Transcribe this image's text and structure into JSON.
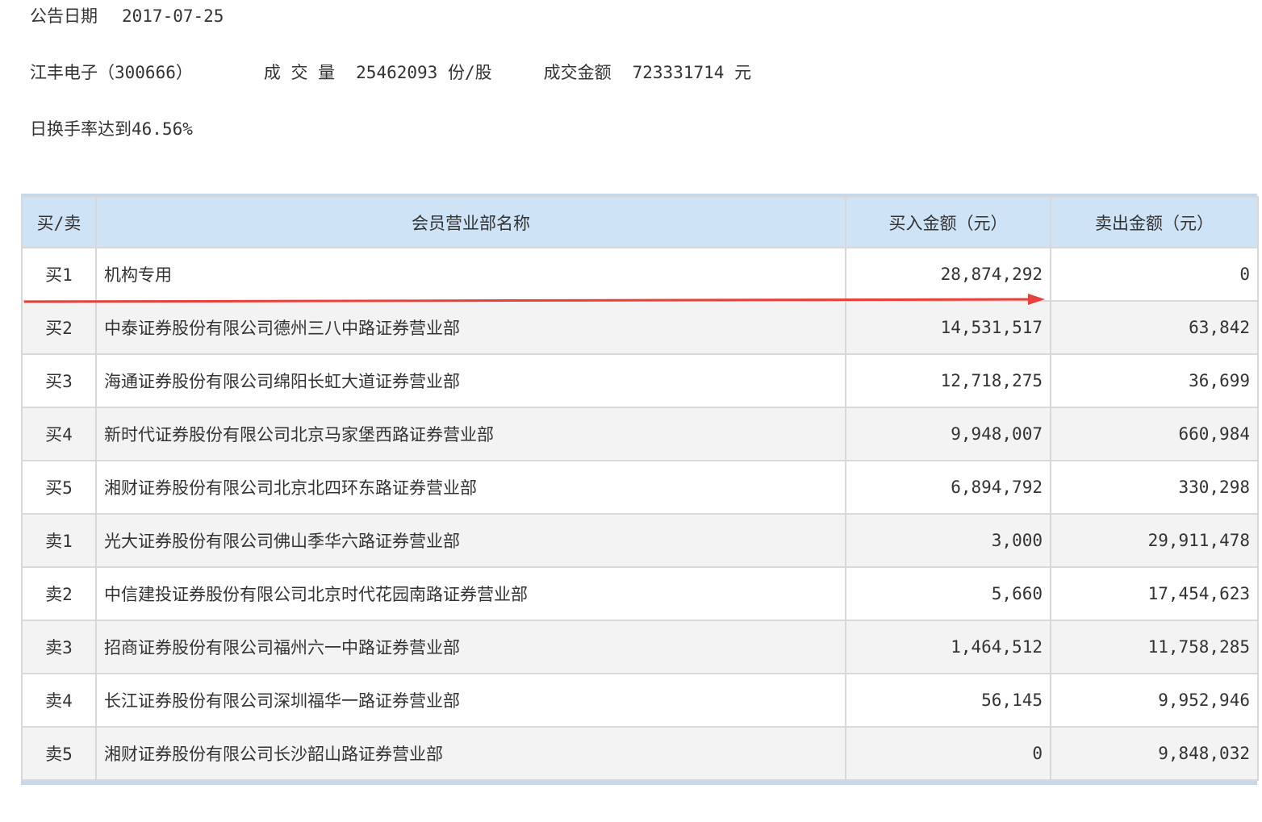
{
  "header": {
    "date_label": "公告日期",
    "date_value": "2017-07-25",
    "stock": "江丰电子（300666）",
    "volume_label": "成 交 量",
    "volume_value": "25462093",
    "volume_unit": "份/股",
    "amount_label": "成交金额",
    "amount_value": "723331714",
    "amount_unit": "元",
    "turnover_text": "日换手率达到46.56%"
  },
  "table": {
    "columns": [
      "买/卖",
      "会员营业部名称",
      "买入金额（元）",
      "卖出金额（元）"
    ],
    "rows": [
      {
        "side": "买1",
        "name": "机构专用",
        "buy": "28,874,292",
        "sell": "0"
      },
      {
        "side": "买2",
        "name": "中泰证券股份有限公司德州三八中路证券营业部",
        "buy": "14,531,517",
        "sell": "63,842"
      },
      {
        "side": "买3",
        "name": "海通证券股份有限公司绵阳长虹大道证券营业部",
        "buy": "12,718,275",
        "sell": "36,699"
      },
      {
        "side": "买4",
        "name": "新时代证券股份有限公司北京马家堡西路证券营业部",
        "buy": "9,948,007",
        "sell": "660,984"
      },
      {
        "side": "买5",
        "name": "湘财证券股份有限公司北京北四环东路证券营业部",
        "buy": "6,894,792",
        "sell": "330,298"
      },
      {
        "side": "卖1",
        "name": "光大证券股份有限公司佛山季华六路证券营业部",
        "buy": "3,000",
        "sell": "29,911,478"
      },
      {
        "side": "卖2",
        "name": "中信建投证券股份有限公司北京时代花园南路证券营业部",
        "buy": "5,660",
        "sell": "17,454,623"
      },
      {
        "side": "卖3",
        "name": "招商证券股份有限公司福州六一中路证券营业部",
        "buy": "1,464,512",
        "sell": "11,758,285"
      },
      {
        "side": "卖4",
        "name": "长江证券股份有限公司深圳福华一路证券营业部",
        "buy": "56,145",
        "sell": "9,952,946"
      },
      {
        "side": "卖5",
        "name": "湘财证券股份有限公司长沙韶山路证券营业部",
        "buy": "0",
        "sell": "9,848,032"
      }
    ]
  },
  "annotation": {
    "arrow_color": "#e8403a"
  },
  "colors": {
    "header_bg": "#cfe3f7",
    "border": "#d8d8d8",
    "stripe": "#f3f3f3"
  }
}
